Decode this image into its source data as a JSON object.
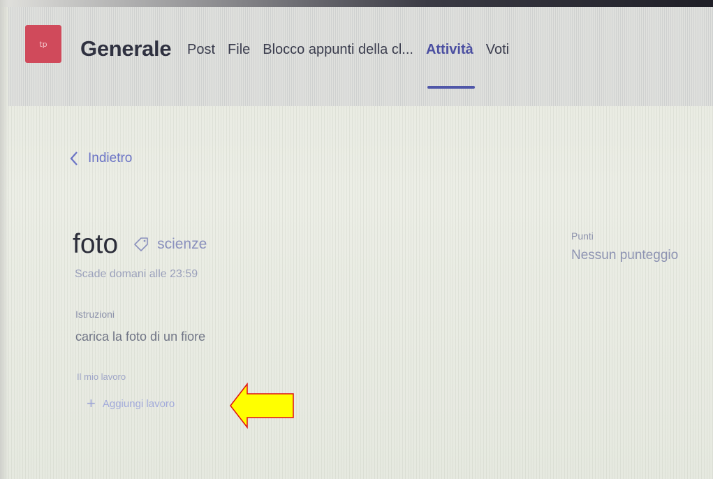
{
  "header": {
    "team_initials": "tp",
    "channel_name": "Generale",
    "tabs": [
      {
        "label": "Post",
        "active": false
      },
      {
        "label": "File",
        "active": false
      },
      {
        "label": "Blocco appunti della cl...",
        "active": false
      },
      {
        "label": "Attività",
        "active": true
      },
      {
        "label": "Voti",
        "active": false
      }
    ]
  },
  "nav": {
    "back_label": "Indietro",
    "back_icon": "chevron-left-icon"
  },
  "assignment": {
    "title": "foto",
    "tag_icon": "tag-icon",
    "category": "scienze",
    "due": "Scade domani alle 23:59",
    "points_label": "Punti",
    "points_value": "Nessun punteggio",
    "instructions_label": "Istruzioni",
    "instructions_text": "carica la foto di un fiore",
    "my_work_label": "Il mio lavoro",
    "add_work_label": "Aggiungi lavoro"
  },
  "annotation": {
    "arrow_color": "#ffff00",
    "arrow_outline": "#e01010"
  },
  "colors": {
    "accent": "#4f56a8",
    "avatar": "#d04a5b"
  }
}
